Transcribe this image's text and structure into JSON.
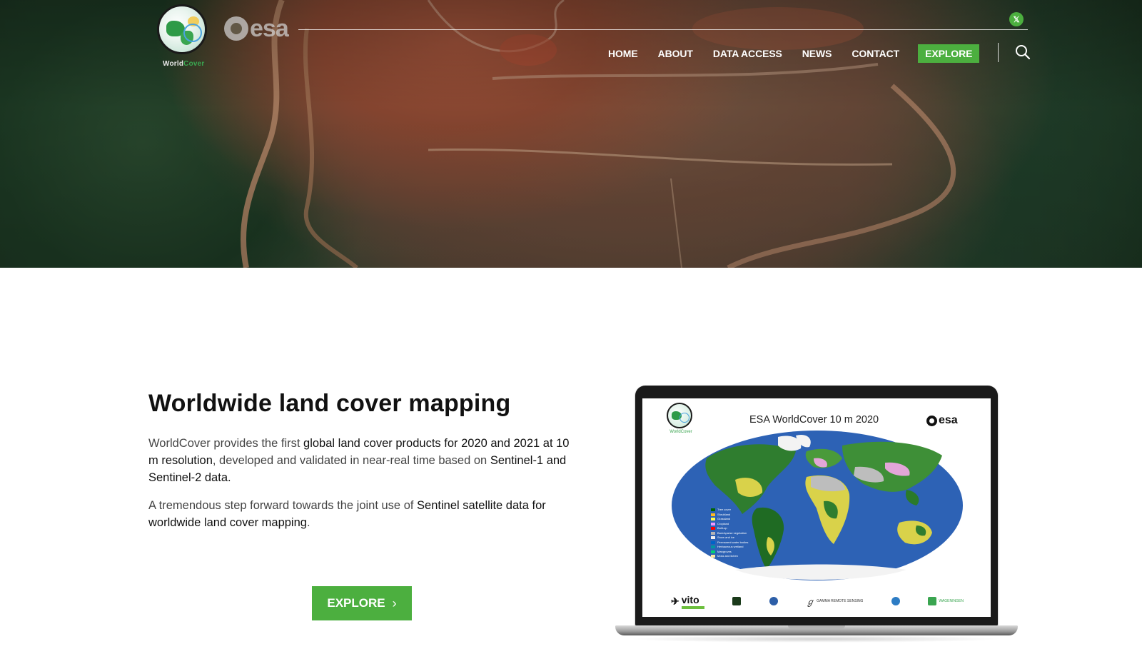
{
  "header": {
    "logo_word_a": "World",
    "logo_word_b": "Cover",
    "esa_text": "esa",
    "x_label": "𝕏",
    "nav": [
      {
        "label": "HOME"
      },
      {
        "label": "ABOUT"
      },
      {
        "label": "DATA ACCESS"
      },
      {
        "label": "NEWS"
      },
      {
        "label": "CONTACT"
      },
      {
        "label": "EXPLORE"
      }
    ],
    "accent": "#4caf3f"
  },
  "main": {
    "title": "Worldwide land cover mapping",
    "p1_a": "WorldCover provides the first ",
    "p1_b": "global land cover products for 2020 and 2021 at 10 m resolution",
    "p1_c": ", developed and validated in near-real time based on ",
    "p1_d": "Sentinel-1 and Sentinel-2 data.",
    "p2_a": "A tremendous step forward towards the joint use of ",
    "p2_b": "Sentinel satellite data for worldwide land cover mapping",
    "p2_c": ".",
    "explore_label": "EXPLORE",
    "explore_chevron": "›"
  },
  "laptop_screen": {
    "title": "ESA WorldCover 10 m 2020",
    "esa_text": "esa",
    "wc_small": "WorldCover",
    "legend": [
      {
        "label": "Tree cover",
        "color": "#006400"
      },
      {
        "label": "Shrubland",
        "color": "#ffbb22"
      },
      {
        "label": "Grassland",
        "color": "#ffff4c"
      },
      {
        "label": "Cropland",
        "color": "#f096ff"
      },
      {
        "label": "Built-up",
        "color": "#fa0000"
      },
      {
        "label": "Bare/sparse vegetation",
        "color": "#b4b4b4"
      },
      {
        "label": "Snow and ice",
        "color": "#f0f0f0"
      },
      {
        "label": "Permanent water bodies",
        "color": "#0064c8"
      },
      {
        "label": "Herbaceous wetland",
        "color": "#0096a0"
      },
      {
        "label": "Mangroves",
        "color": "#00cf75"
      },
      {
        "label": "Moss and lichen",
        "color": "#fae6a0"
      }
    ],
    "partners": [
      {
        "label": "vito"
      },
      {
        "label": "GAMMA REMOTE SENSING"
      },
      {
        "label": "WAGENINGEN"
      }
    ]
  }
}
